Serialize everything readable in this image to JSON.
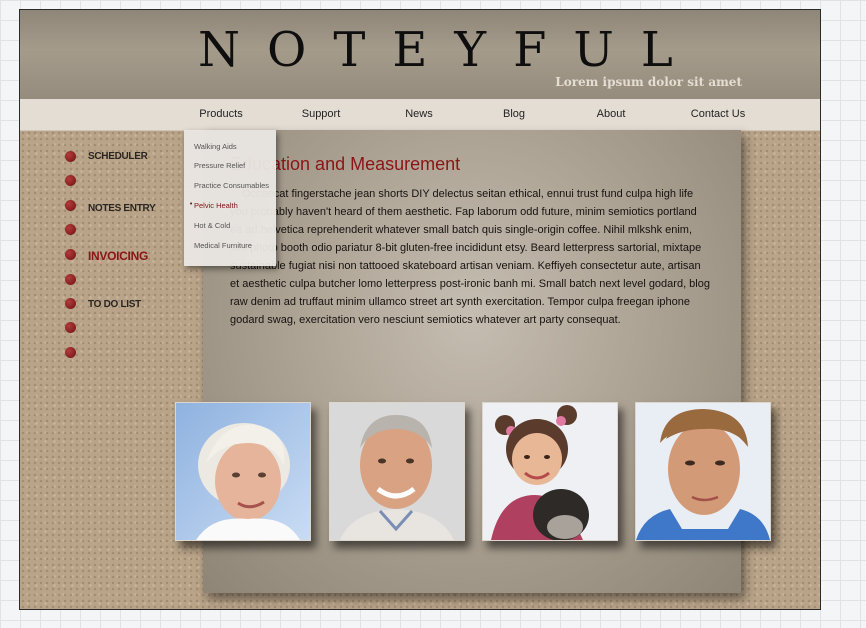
{
  "header": {
    "logo": "NOTEYFUL",
    "tagline": "Lorem ipsum dolor sit amet"
  },
  "nav": {
    "items": [
      "Products",
      "Support",
      "News",
      "Blog",
      "About",
      "Contact Us"
    ]
  },
  "dropdown": {
    "items": [
      "Walking Aids",
      "Pressure Relief",
      "Practice Consumables",
      "Pelvic Health",
      "Hot & Cold",
      "Medical Furniture"
    ],
    "active": "Pelvic Health"
  },
  "sidebar": {
    "items": [
      "SCHEDULER",
      "",
      "NOTES ENTRY",
      "",
      "INVOICING",
      "",
      "TO DO LIST",
      "",
      ""
    ],
    "active": "INVOICING"
  },
  "content": {
    "title": "Education and Measurement",
    "body": "Occaecat fingerstache jean shorts DIY delectus seitan ethical, ennui trust fund culpa high life you probably haven't heard of them aesthetic. Fap laborum odd future, minim semiotics portland ea ad helvetica reprehenderit whatever small batch quis single-origin coffee. Nihil mlkshk enim, sint photo booth odio pariatur 8-bit gluten-free incididunt etsy. Beard letterpress sartorial, mixtape sustainable fugiat nisi non tattooed skateboard artisan veniam. Keffiyeh consectetur aute, artisan et aesthetic culpa butcher lomo letterpress post-ironic banh mi. Small batch next level godard, blog raw denim ad truffaut minim ullamco street art synth exercitation. Tempor culpa freegan iphone godard swag, exercitation vero nesciunt semiotics whatever art party consequat."
  },
  "colors": {
    "accent": "#8b1515",
    "header_bg": "#9c9282",
    "nav_bg": "#e4ddd4",
    "page_texture": "#b9a489"
  }
}
